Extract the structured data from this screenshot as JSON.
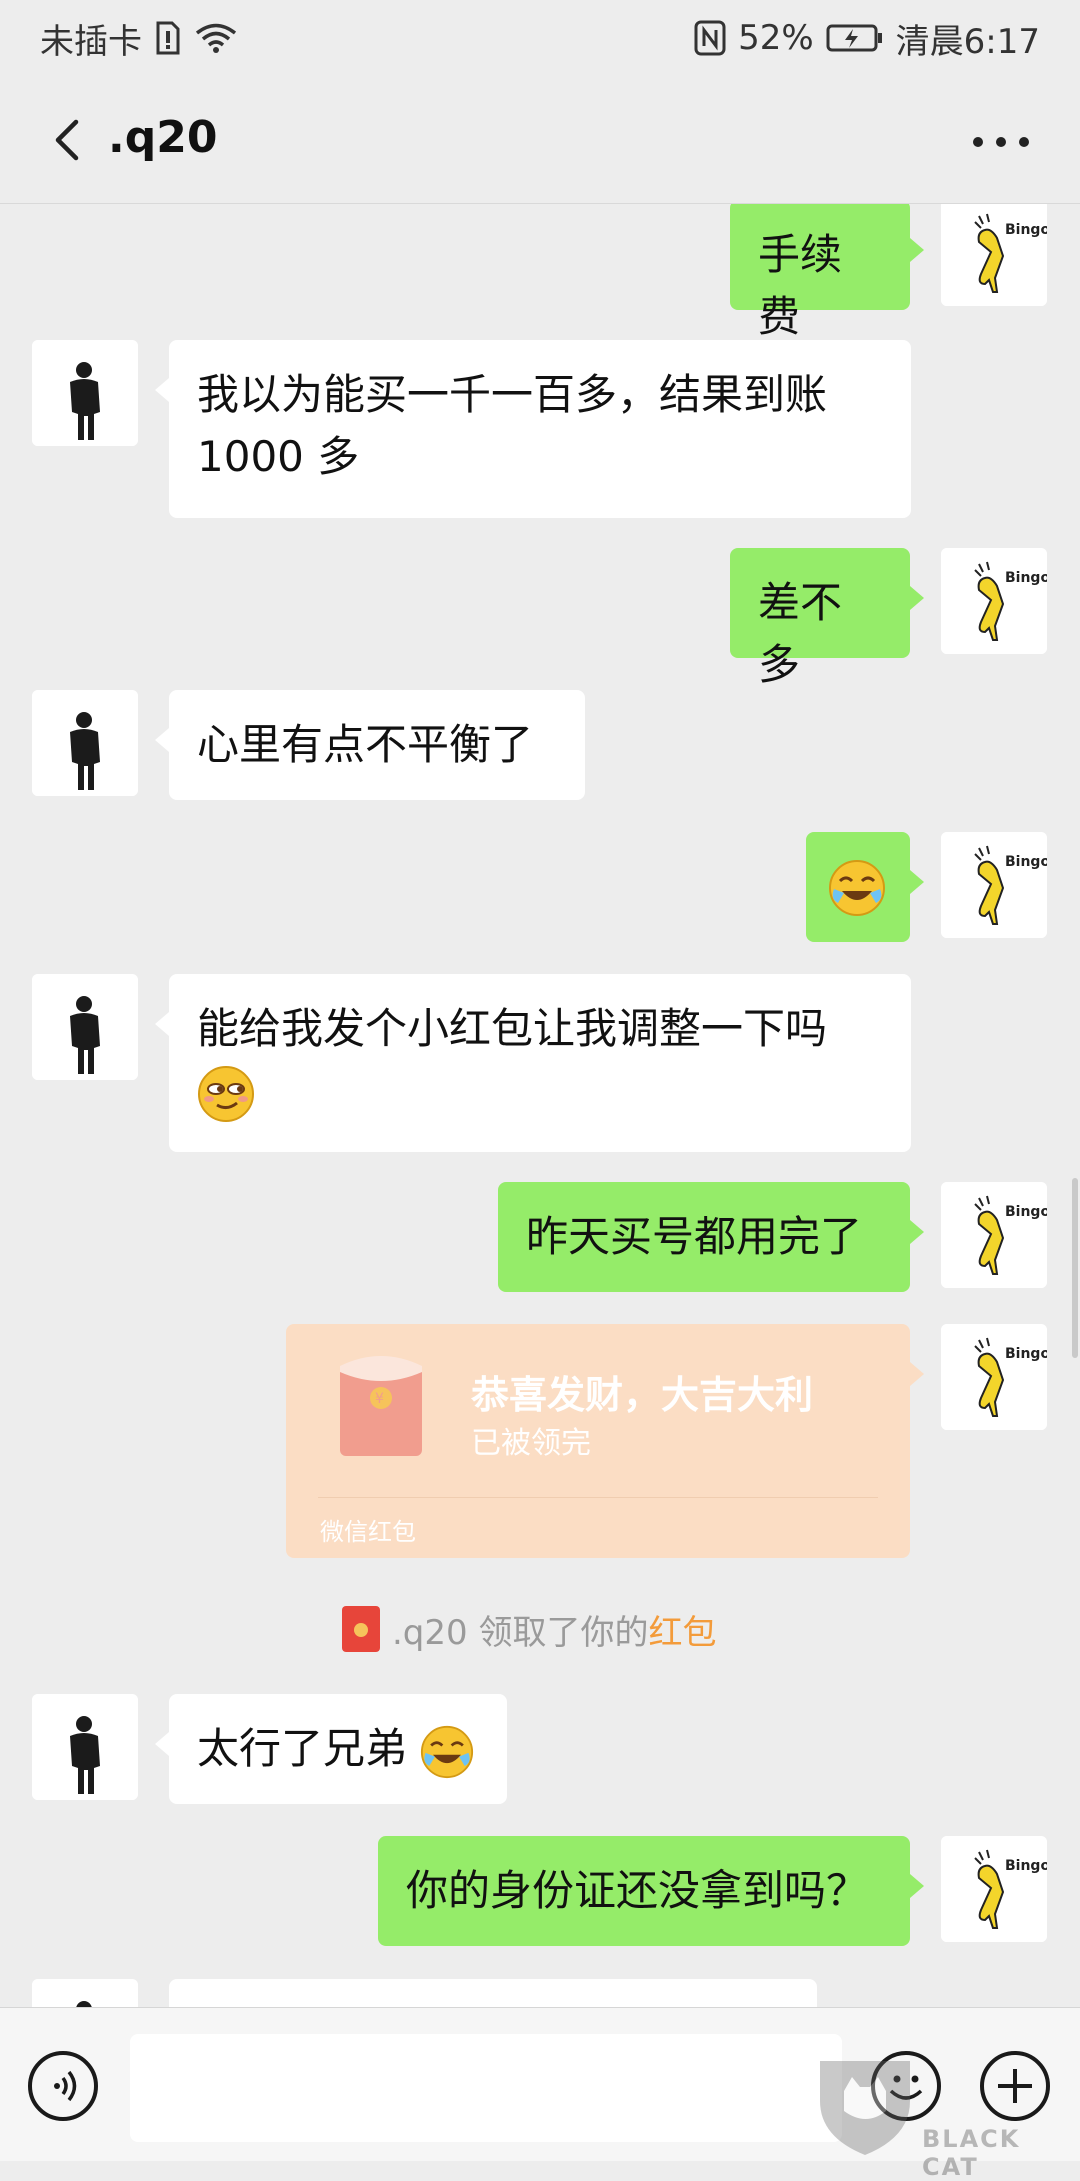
{
  "status_bar": {
    "carrier": "未插卡",
    "battery": "52%",
    "time": "清晨6:17"
  },
  "nav": {
    "title": ".q20"
  },
  "messages": [
    {
      "side": "out",
      "text": "手续费"
    },
    {
      "side": "in",
      "text": "我以为能买一千一百多，结果到账1000 多"
    },
    {
      "side": "out",
      "text": "差不多"
    },
    {
      "side": "in",
      "text": "心里有点不平衡了"
    },
    {
      "side": "out",
      "emoji": "crying-laughing-emoji"
    },
    {
      "side": "in",
      "text": "能给我发个小红包让我调整一下吗",
      "emoji": "smirk-emoji"
    },
    {
      "side": "out",
      "text": "昨天买号都用完了"
    },
    {
      "side": "out",
      "text": "太行了兄弟"
    },
    {
      "side": "out",
      "text": "你的身份证还没拿到吗？"
    }
  ],
  "red_packet": {
    "title": "恭喜发财，大吉大利",
    "status": "已被领完",
    "footer": "微信红包",
    "color": "#fbddc4"
  },
  "system_message": {
    "prefix": ".q20 领取了你的",
    "link": "红包"
  },
  "colors": {
    "background": "#ededed",
    "outgoing_bubble": "#95ec69",
    "incoming_bubble": "#ffffff",
    "link": "#f39b3a"
  },
  "watermark": {
    "text": "BLACK CAT"
  }
}
